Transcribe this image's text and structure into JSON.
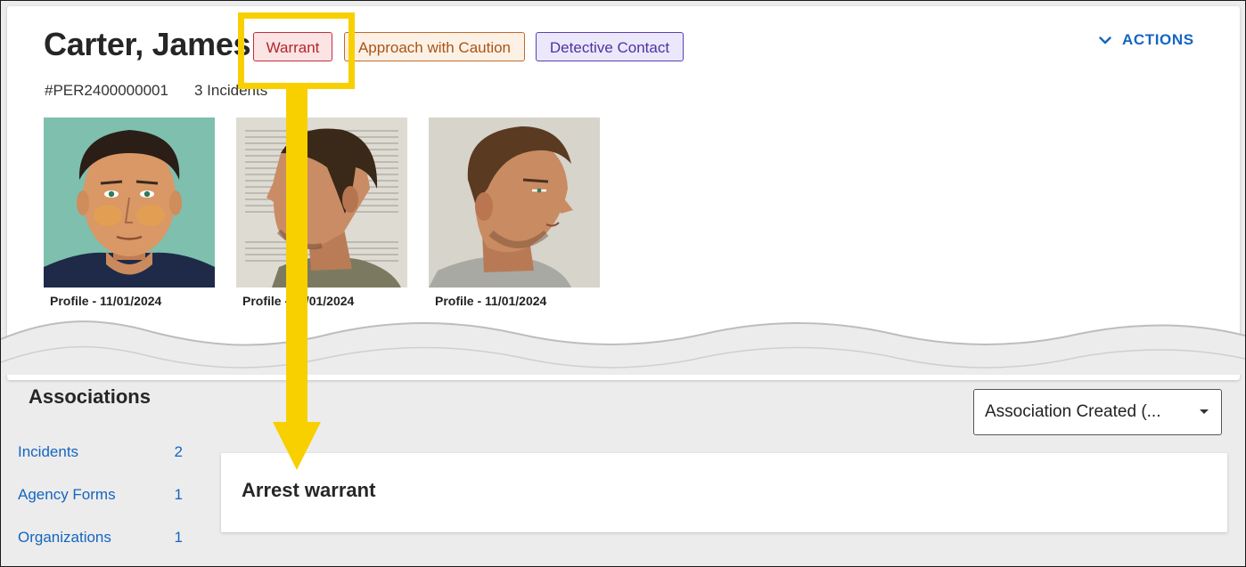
{
  "person": {
    "name": "Carter, James",
    "id": "#PER2400000001",
    "incidents": "3 Incidents",
    "badges": {
      "warrant": "Warrant",
      "caution": "Approach with Caution",
      "detective": "Detective Contact"
    },
    "actions_label": "ACTIONS",
    "photos": [
      {
        "caption": "Profile - 11/01/2024"
      },
      {
        "caption": "Profile - 11/01/2024"
      },
      {
        "caption": "Profile - 11/01/2024"
      }
    ]
  },
  "associations": {
    "title": "Associations",
    "items": [
      {
        "label": "Incidents",
        "count": "2"
      },
      {
        "label": "Agency Forms",
        "count": "1"
      },
      {
        "label": "Organizations",
        "count": "1"
      }
    ],
    "sort_selected": "Association Created (...",
    "result_title": "Arrest warrant"
  },
  "colors": {
    "accent": "#1565c0",
    "warrant": "#c0303a",
    "caution": "#c0692a",
    "detective": "#5b3fb5",
    "callout": "#f8d000"
  },
  "icons": {
    "actions": "chevron-down-icon",
    "sort": "caret-down-icon"
  }
}
